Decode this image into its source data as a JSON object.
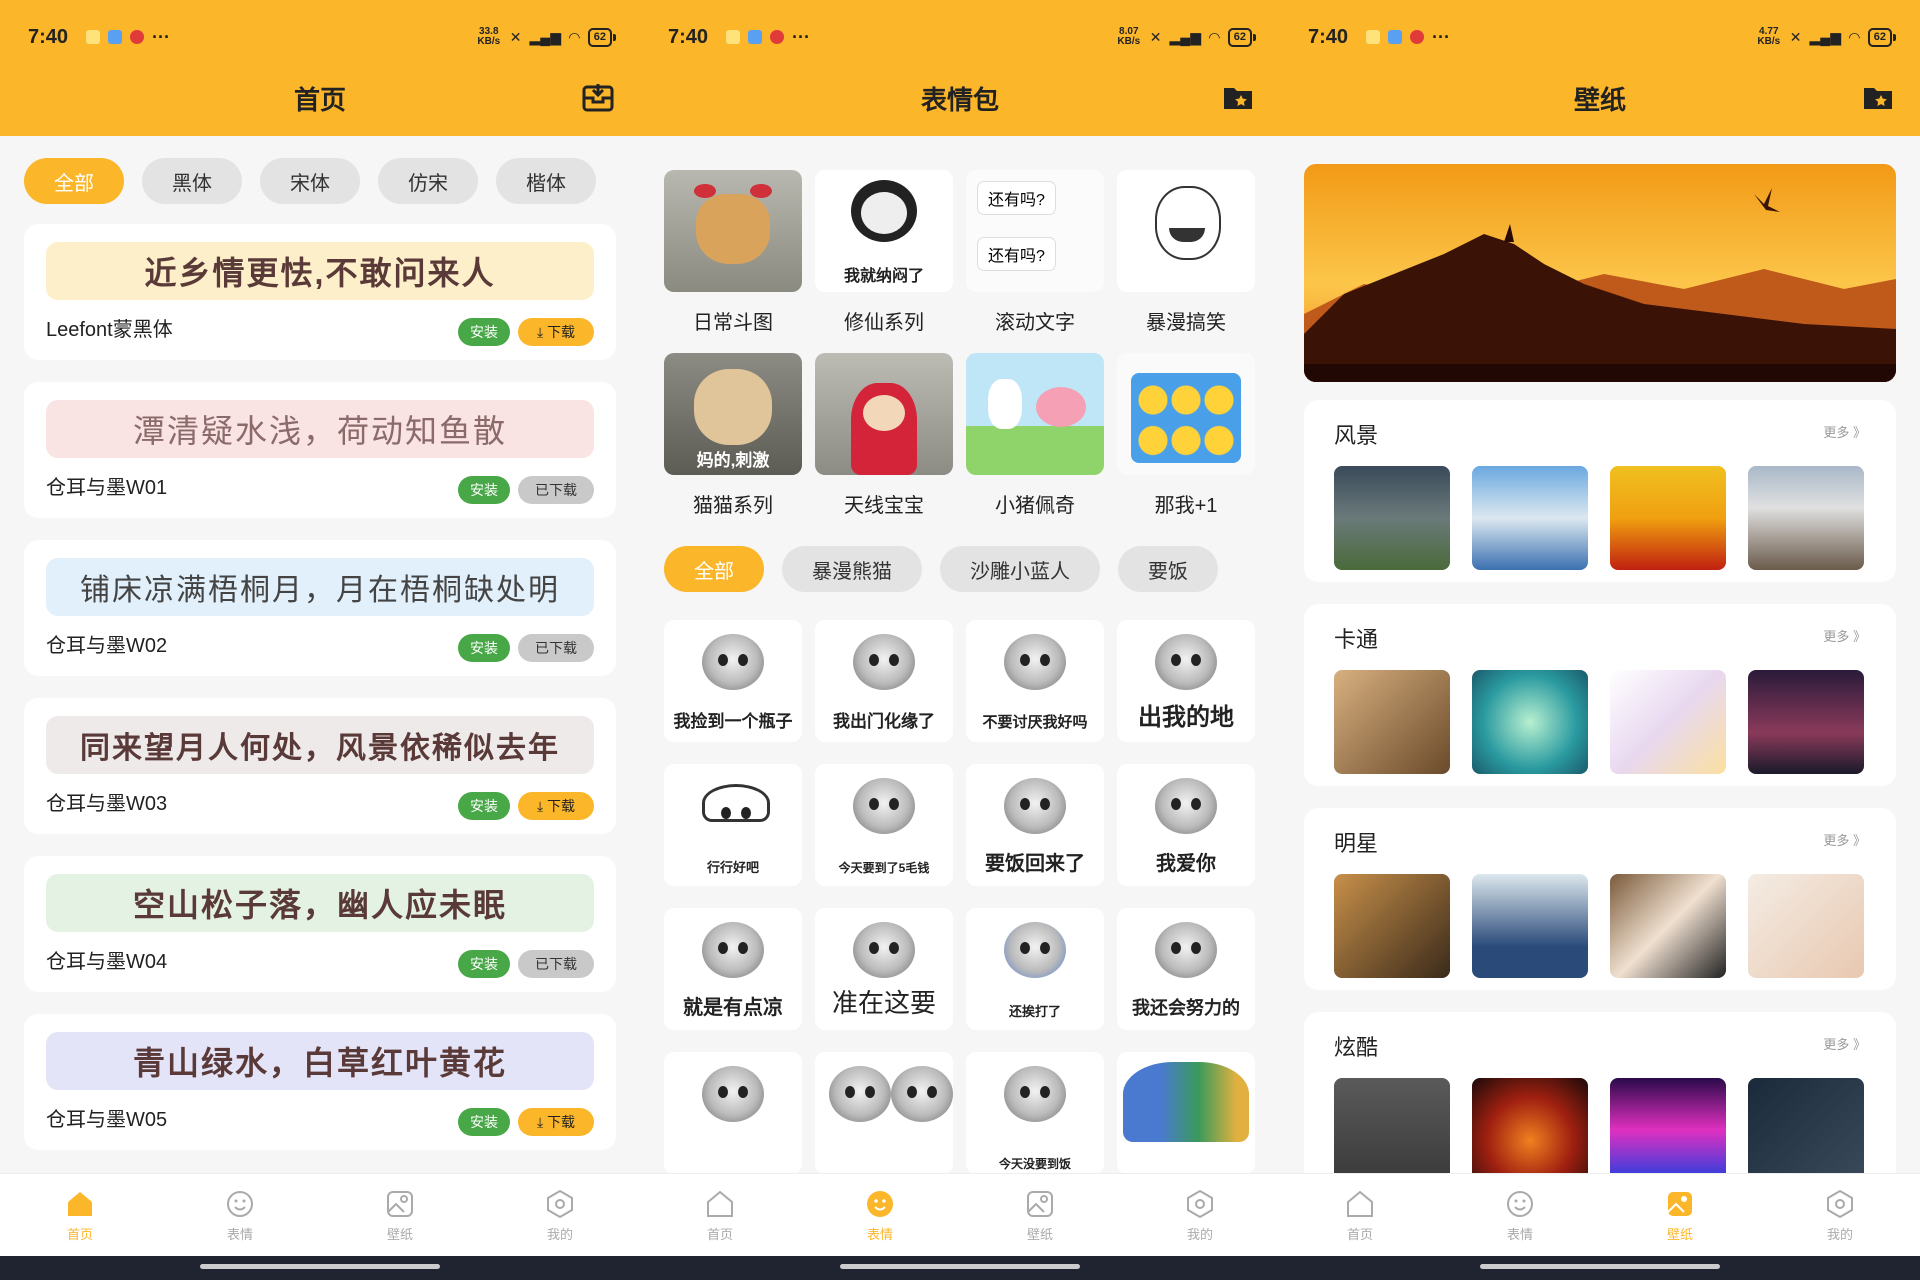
{
  "status": {
    "time": "7:40",
    "dots": "···",
    "battery": "62"
  },
  "phones": [
    {
      "netspeed": "33.8 KB/s"
    },
    {
      "netspeed": "8.07 KB/s"
    },
    {
      "netspeed": "4.77 KB/s"
    }
  ],
  "home": {
    "title": "首页",
    "filters": [
      "全部",
      "黑体",
      "宋体",
      "仿宋",
      "楷体"
    ],
    "fonts": [
      {
        "sample": "近乡情更怯,不敢问来人",
        "name": "Leefont蒙黑体",
        "install": "安装",
        "download": "下载",
        "downloaded": false
      },
      {
        "sample": "潭清疑水浅，荷动知鱼散",
        "name": "仓耳与墨W01",
        "install": "安装",
        "download": "已下载",
        "downloaded": true
      },
      {
        "sample": "铺床凉满梧桐月，月在梧桐缺处明",
        "name": "仓耳与墨W02",
        "install": "安装",
        "download": "已下载",
        "downloaded": true
      },
      {
        "sample": "同来望月人何处，风景依稀似去年",
        "name": "仓耳与墨W03",
        "install": "安装",
        "download": "下载",
        "downloaded": false
      },
      {
        "sample": "空山松子落，幽人应未眠",
        "name": "仓耳与墨W04",
        "install": "安装",
        "download": "已下载",
        "downloaded": true
      },
      {
        "sample": "青山绿水，白草红叶黄花",
        "name": "仓耳与墨W05",
        "install": "安装",
        "download": "下载",
        "downloaded": false
      }
    ]
  },
  "emoji": {
    "title": "表情包",
    "categories": [
      "日常斗图",
      "修仙系列",
      "滚动文字",
      "暴漫搞笑",
      "猫猫系列",
      "天线宝宝",
      "小猪佩奇",
      "那我+1"
    ],
    "category_captions": [
      "",
      "我就纳闷了",
      "还有吗?",
      "",
      "妈的,刺激",
      "",
      "",
      ""
    ],
    "filters": [
      "全部",
      "暴漫熊猫",
      "沙雕小蓝人",
      "要饭"
    ],
    "stickers": [
      "我捡到一个瓶子",
      "我出门化缘了",
      "不要讨厌我好吗",
      "出我的地",
      "行行好吧",
      "今天要到了5毛钱",
      "要饭回来了",
      "我爱你",
      "就是有点凉",
      "准在这要",
      "还挨打了",
      "我还会努力的",
      "",
      "",
      "今天没要到饭",
      ""
    ]
  },
  "wallpaper": {
    "title": "壁纸",
    "more": "更多 》",
    "sections": [
      "风景",
      "卡通",
      "明星",
      "炫酷"
    ]
  },
  "nav": [
    "首页",
    "表情",
    "壁纸",
    "我的"
  ],
  "colors": {
    "accent": "#fbb62a",
    "install": "#48a848",
    "downloaded": "#c9c9c9",
    "card": "#ffffff",
    "bg": "#f6f6f6"
  }
}
